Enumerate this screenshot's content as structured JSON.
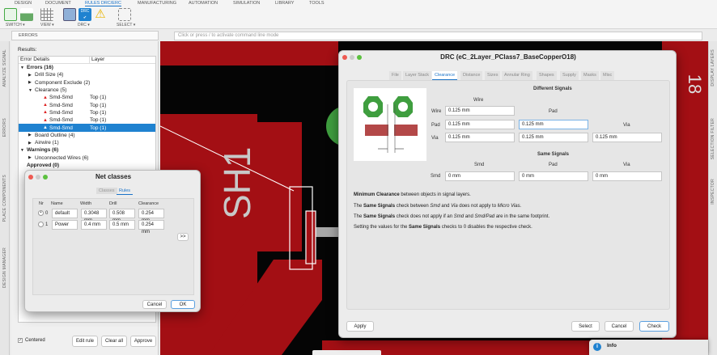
{
  "ribbon": {
    "tabs": [
      "DESIGN",
      "DOCUMENT",
      "RULES DRC/ERC",
      "MANUFACTURING",
      "AUTOMATION",
      "SIMULATION",
      "LIBRARY",
      "TOOLS"
    ],
    "active_tab": "RULES DRC/ERC",
    "groups": [
      "SWITCH ▾",
      "VIEW ▾",
      "DRC ▾",
      "SELECT ▾"
    ],
    "drc_icon_text": "DRC"
  },
  "command": {
    "placeholder": "Click or press / to activate command line mode"
  },
  "left_tabs": [
    "ANALYZE SIGNAL",
    "ERRORS",
    "PLACE COMPONENTS",
    "DESIGN MANAGER"
  ],
  "right_tabs": [
    "DISPLAY LAYERS",
    "SELECTION FILTER",
    "INSPECTOR"
  ],
  "errors_panel": {
    "title": "ERRORS",
    "results_label": "Results:",
    "columns": [
      "Error Details",
      "Layer"
    ],
    "rows": [
      {
        "indent": 0,
        "toggle": "▼",
        "label": "Errors (16)",
        "layer": "",
        "bold": true
      },
      {
        "indent": 1,
        "toggle": "▶",
        "label": "Drill Size (4)",
        "layer": ""
      },
      {
        "indent": 1,
        "toggle": "▶",
        "label": "Component Exclude (2)",
        "layer": ""
      },
      {
        "indent": 1,
        "toggle": "▼",
        "label": "Clearance (5)",
        "layer": ""
      },
      {
        "indent": 2,
        "toggle": "",
        "label": "Smd-Smd",
        "layer": "Top (1)",
        "warn": true
      },
      {
        "indent": 2,
        "toggle": "",
        "label": "Smd-Smd",
        "layer": "Top (1)",
        "warn": true
      },
      {
        "indent": 2,
        "toggle": "",
        "label": "Smd-Smd",
        "layer": "Top (1)",
        "warn": true
      },
      {
        "indent": 2,
        "toggle": "",
        "label": "Smd-Smd",
        "layer": "Top (1)",
        "warn": true
      },
      {
        "indent": 2,
        "toggle": "",
        "label": "Smd-Smd",
        "layer": "Top (1)",
        "warn": true,
        "selected": true
      },
      {
        "indent": 1,
        "toggle": "▶",
        "label": "Board Outline (4)",
        "layer": ""
      },
      {
        "indent": 1,
        "toggle": "▶",
        "label": "Airwire (1)",
        "layer": ""
      },
      {
        "indent": 0,
        "toggle": "▼",
        "label": "Warnings (6)",
        "layer": "",
        "bold": true
      },
      {
        "indent": 1,
        "toggle": "▶",
        "label": "Unconnected Wires (6)",
        "layer": ""
      },
      {
        "indent": 0,
        "toggle": "",
        "label": "Approved (0)",
        "layer": "",
        "bold": true
      }
    ],
    "centered_label": "Centered",
    "centered_checked": true,
    "buttons": [
      "Edit rule",
      "Clear all",
      "Approve"
    ]
  },
  "netclasses": {
    "title": "Net classes",
    "tabs": [
      "Classes",
      "Rules"
    ],
    "active_tab": "Rules",
    "columns": [
      "Nr",
      "Name",
      "Width",
      "Drill",
      "Clearance"
    ],
    "rows": [
      {
        "nr": "0",
        "name": "default",
        "width": "0.3048 mm",
        "drill": "0.508 mm",
        "clearance": "0.254 mm",
        "selected": true
      },
      {
        "nr": "1",
        "name": "Power",
        "width": "0.4 mm",
        "drill": "0.5 mm",
        "clearance": "0.254 mm",
        "selected": false
      }
    ],
    "expand": ">>",
    "cancel": "Cancel",
    "ok": "OK"
  },
  "drc": {
    "title": "DRC (eC_2Layer_PClass7_BaseCopperO18)",
    "tabs": [
      "File",
      "Layer Stack",
      "Clearance",
      "Distance",
      "Sizes",
      "Annular Ring",
      "Shapes",
      "Supply",
      "Masks",
      "Misc"
    ],
    "active_tab": "Clearance",
    "different_title": "Different Signals",
    "same_title": "Same Signals",
    "col_wire": "Wire",
    "col_pad": "Pad",
    "col_via": "Via",
    "row_wire": "Wire",
    "row_pad": "Pad",
    "row_via": "Via",
    "wire_wire": "0.125 mm",
    "pad_wire": "0.125 mm",
    "pad_pad": "0.125 mm",
    "via_wire": "0.125 mm",
    "via_pad": "0.125 mm",
    "via_via": "0.125 mm",
    "same_col_smd": "Smd",
    "same_col_pad": "Pad",
    "same_col_via": "Via",
    "same_row_smd": "Smd",
    "smd_smd": "0 mm",
    "smd_pad": "0 mm",
    "smd_via": "0 mm",
    "notes": {
      "n1_b": "Minimum Clearance",
      "n1": " between objects in signal layers.",
      "n2_a": "The ",
      "n2_b": "Same Signals",
      "n2_c": " check between ",
      "n2_d": "Smd",
      "n2_e": " and ",
      "n2_f": "Via",
      "n2_g": " does not apply to ",
      "n2_h": "Micro Vias.",
      "n3_a": "The ",
      "n3_b": "Same Signals",
      "n3_c": " check does not apply if an ",
      "n3_d": "Smd",
      "n3_e": " and ",
      "n3_f": "Smd/Pad",
      "n3_g": " are in the same footprint.",
      "n4_a": "Setting the values for the ",
      "n4_b": "Same Signals",
      "n4_c": " checks to 0 disables the respective check."
    },
    "apply": "Apply",
    "select": "Select",
    "cancel": "Cancel",
    "check": "Check"
  },
  "canvas": {
    "silkscreen": "SH1",
    "corner_text": "18"
  },
  "toast": {
    "title": "Info"
  },
  "colors": {
    "board_red": "#a30f14",
    "accent": "#1f82d0",
    "pad_green": "#3f9e3f",
    "pad_red": "#b34848"
  }
}
